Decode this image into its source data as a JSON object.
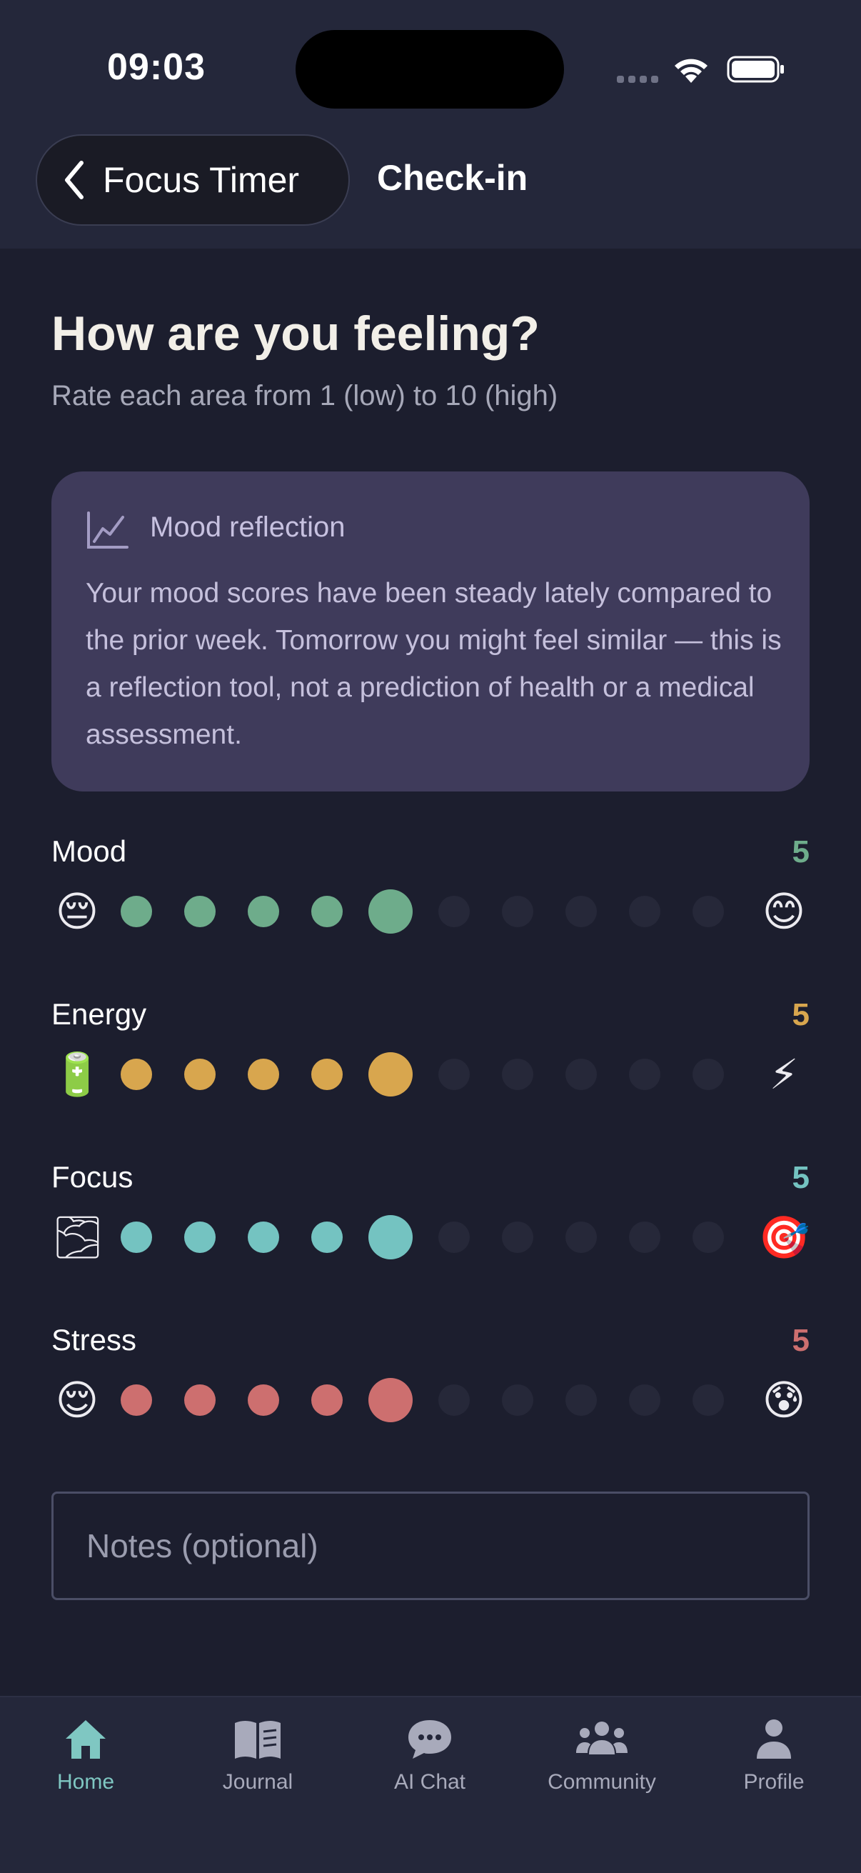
{
  "status_bar": {
    "time": "09:03"
  },
  "nav": {
    "back_label": "Focus Timer",
    "title": "Check-in"
  },
  "header": {
    "title": "How are you feeling?",
    "subtitle": "Rate each area from 1 (low) to 10 (high)"
  },
  "reflection": {
    "icon": "chart-line-icon",
    "title": "Mood reflection",
    "body": "Your mood scores have been steady lately compared to the prior week. Tomorrow you might feel similar — this is a reflection tool, not a prediction of health or a medical assessment."
  },
  "metrics": [
    {
      "label": "Mood",
      "value": "5",
      "low_emoji": "😔",
      "high_emoji": "😊",
      "color": "#6eac8b"
    },
    {
      "label": "Energy",
      "value": "5",
      "low_emoji": "🔋",
      "high_emoji": "⚡",
      "color": "#d8a64e"
    },
    {
      "label": "Focus",
      "value": "5",
      "low_emoji": "🌫",
      "high_emoji": "🎯",
      "color": "#74c3c1"
    },
    {
      "label": "Stress",
      "value": "5",
      "low_emoji": "😌",
      "high_emoji": "😰",
      "color": "#cd6f6f"
    }
  ],
  "scale": {
    "min": 1,
    "max": 10
  },
  "notes": {
    "placeholder": "Notes (optional)",
    "value": ""
  },
  "tabs": [
    {
      "label": "Home",
      "icon": "home-icon",
      "active": true
    },
    {
      "label": "Journal",
      "icon": "book-icon",
      "active": false
    },
    {
      "label": "AI Chat",
      "icon": "chat-bubble-icon",
      "active": false
    },
    {
      "label": "Community",
      "icon": "users-icon",
      "active": false
    },
    {
      "label": "Profile",
      "icon": "person-icon",
      "active": false
    }
  ],
  "colors": {
    "background": "#1c1e2e",
    "surface": "#24273a",
    "card": "#3f3b5b",
    "accent": "#7fc7c2"
  }
}
